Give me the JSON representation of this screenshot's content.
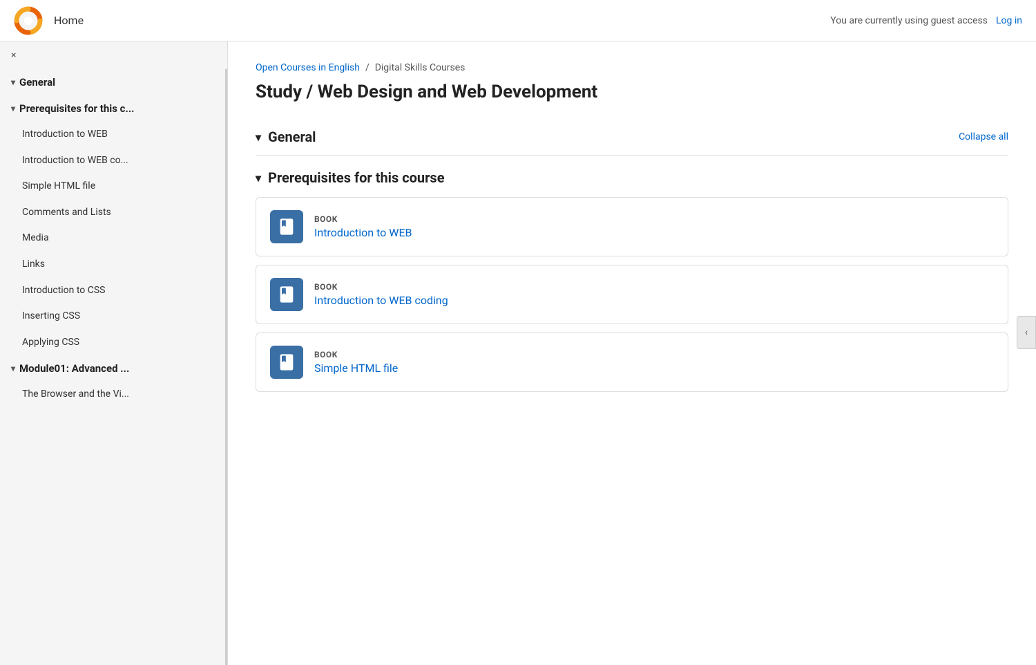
{
  "header": {
    "home_label": "Home",
    "guest_message": "You are currently using guest access",
    "login_label": "Log in"
  },
  "sidebar": {
    "close_icon": "×",
    "sections": [
      {
        "id": "general",
        "label": "General",
        "expanded": true,
        "items": []
      },
      {
        "id": "prerequisites",
        "label": "Prerequisites for this c...",
        "expanded": true,
        "items": [
          "Introduction to WEB",
          "Introduction to WEB co...",
          "Simple HTML file",
          "Comments and Lists",
          "Media",
          "Links",
          "Introduction to CSS",
          "Inserting CSS",
          "Applying CSS"
        ]
      },
      {
        "id": "module01",
        "label": "Module01: Advanced ...",
        "expanded": true,
        "items": [
          "The Browser and the Vi..."
        ]
      }
    ]
  },
  "breadcrumb": {
    "link_text": "Open Courses in English",
    "separator": "/",
    "current": "Digital Skills Courses"
  },
  "page_title": "Study / Web Design and Web Development",
  "general_section": {
    "label": "General",
    "collapse_all_label": "Collapse all"
  },
  "prerequisites_section": {
    "label": "Prerequisites for this course"
  },
  "books": [
    {
      "type": "BOOK",
      "title": "Introduction to WEB"
    },
    {
      "type": "BOOK",
      "title": "Introduction to WEB coding"
    },
    {
      "type": "BOOK",
      "title": "Simple HTML file"
    }
  ]
}
